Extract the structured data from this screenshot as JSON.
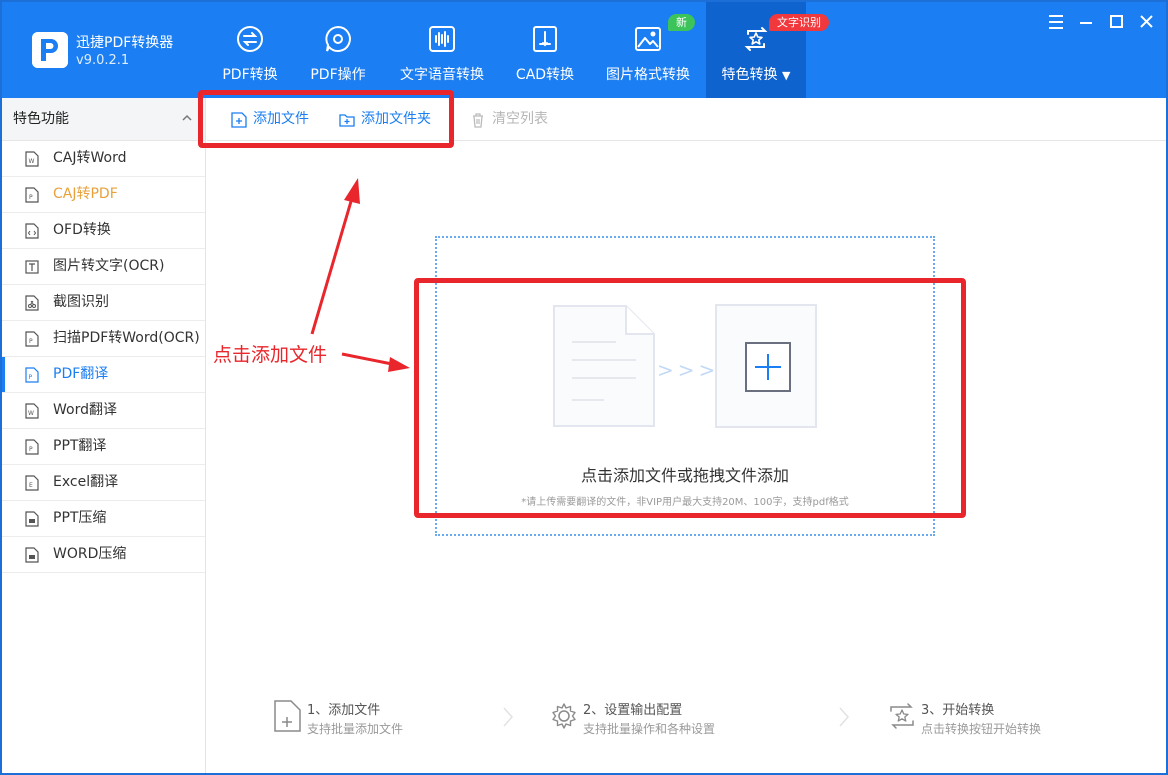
{
  "app": {
    "name": "迅捷PDF转换器",
    "version": "v9.0.2.1"
  },
  "nav": {
    "tabs": [
      {
        "label": "PDF转换",
        "icon": "pdf-convert-icon"
      },
      {
        "label": "PDF操作",
        "icon": "pdf-operate-icon"
      },
      {
        "label": "文字语音转换",
        "icon": "audio-wave-icon"
      },
      {
        "label": "CAD转换",
        "icon": "cad-icon"
      },
      {
        "label": "图片格式转换",
        "icon": "image-icon"
      },
      {
        "label": "特色转换",
        "icon": "star-convert-icon",
        "active": true
      }
    ],
    "badge_new": "新",
    "badge_ocr": "文字识别"
  },
  "sidebar": {
    "title": "特色功能",
    "items": [
      {
        "label": "CAJ转Word"
      },
      {
        "label": "CAJ转PDF"
      },
      {
        "label": "OFD转换"
      },
      {
        "label": "图片转文字(OCR)"
      },
      {
        "label": "截图识别"
      },
      {
        "label": "扫描PDF转Word(OCR)"
      },
      {
        "label": "PDF翻译",
        "active": true
      },
      {
        "label": "Word翻译"
      },
      {
        "label": "PPT翻译"
      },
      {
        "label": "Excel翻译"
      },
      {
        "label": "PPT压缩"
      },
      {
        "label": "WORD压缩"
      }
    ]
  },
  "toolbar": {
    "add_file": "添加文件",
    "add_folder": "添加文件夹",
    "clear_list": "清空列表"
  },
  "dropzone": {
    "main_text": "点击添加文件或拖拽文件添加",
    "sub_text": "*请上传需要翻译的文件，非VIP用户最大支持20M、100字，支持pdf格式"
  },
  "steps": [
    {
      "title": "1、添加文件",
      "desc": "支持批量添加文件"
    },
    {
      "title": "2、设置输出配置",
      "desc": "支持批量操作和各种设置"
    },
    {
      "title": "3、开始转换",
      "desc": "点击转换按钮开始转换"
    }
  ],
  "annotation": {
    "text": "点击添加文件"
  },
  "colors": {
    "brand": "#1b7ef2",
    "active_tab": "#0f63cf",
    "annotation_red": "#e8262b",
    "badge_green": "#3cc45b",
    "orange_item": "#e8a13a"
  }
}
